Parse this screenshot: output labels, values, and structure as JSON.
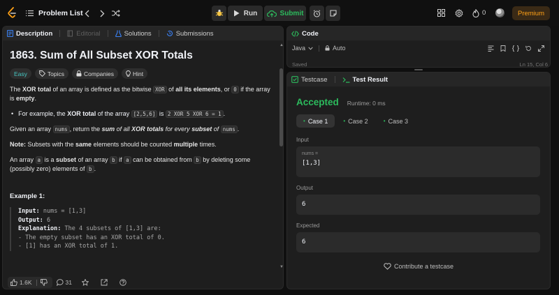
{
  "header": {
    "problem_list_label": "Problem List",
    "run_label": "Run",
    "submit_label": "Submit",
    "streak_count": "0",
    "premium_label": "Premium"
  },
  "description_panel": {
    "tabs": [
      "Description",
      "Editorial",
      "Solutions",
      "Submissions"
    ],
    "title": "1863. Sum of All Subset XOR Totals",
    "chips": [
      "Easy",
      "Topics",
      "Companies",
      "Hint"
    ],
    "p1": {
      "a": "The ",
      "b": "XOR total",
      "c": " of an array is defined as the bitwise ",
      "d": "XOR",
      "e": " of ",
      "f": "all its elements",
      "g": ", or ",
      "h": "0",
      "i": " if the array is ",
      "j": "empty",
      "k": "."
    },
    "bullet1": {
      "a": "For example, the ",
      "b": "XOR total",
      "c": " of the array ",
      "d": "[2,5,6]",
      "e": " is ",
      "f": "2 XOR 5 XOR 6 = 1",
      "g": "."
    },
    "p2": {
      "a": "Given an array ",
      "b": "nums",
      "c": ", return the ",
      "d": "sum",
      "e": " of all ",
      "f": "XOR totals",
      "g": " for every ",
      "h": "subset",
      "i": " of ",
      "j": "nums",
      "k": "."
    },
    "p3": {
      "a": "Note:",
      "b": " Subsets with the ",
      "c": "same",
      "d": " elements should be counted ",
      "e": "multiple",
      "f": " times."
    },
    "p4": {
      "a": "An array ",
      "b": "a",
      "c": " is a ",
      "d": "subset",
      "e": " of an array ",
      "f": "b",
      "g": " if ",
      "h": "a",
      "i": " can be obtained from ",
      "j": "b",
      "k": " by deleting some (possibly zero) elements of ",
      "l": "b",
      "m": "."
    },
    "example_title": "Example 1:",
    "example": {
      "input_label": "Input:",
      "input_value": " nums = [1,3]",
      "output_label": "Output:",
      "output_value": " 6",
      "explanation_label": "Explanation:",
      "explanation_value": " The 4 subsets of [1,3] are:",
      "line1": "- The empty subset has an XOR total of 0.",
      "line2": "- [1] has an XOR total of 1."
    },
    "footer": {
      "likes": "1.6K",
      "comments": "31"
    }
  },
  "code_panel": {
    "title": "Code",
    "language": "Java",
    "mode": "Auto",
    "status": "Saved",
    "cursor": "Ln 15, Col 6"
  },
  "result_panel": {
    "tabs": [
      "Testcase",
      "Test Result"
    ],
    "verdict": "Accepted",
    "runtime": "Runtime: 0 ms",
    "cases": [
      "Case 1",
      "Case 2",
      "Case 3"
    ],
    "input_label": "Input",
    "param_name": "nums =",
    "param_value": "[1,3]",
    "output_label": "Output",
    "output_value": "6",
    "expected_label": "Expected",
    "expected_value": "6",
    "contribute_label": "Contribute a testcase"
  },
  "colors": {
    "accent_green": "#2cbb5d",
    "premium_orange": "#ffa116",
    "easy_teal": "#46c6c2",
    "tab_blue": "#3b82f6"
  }
}
